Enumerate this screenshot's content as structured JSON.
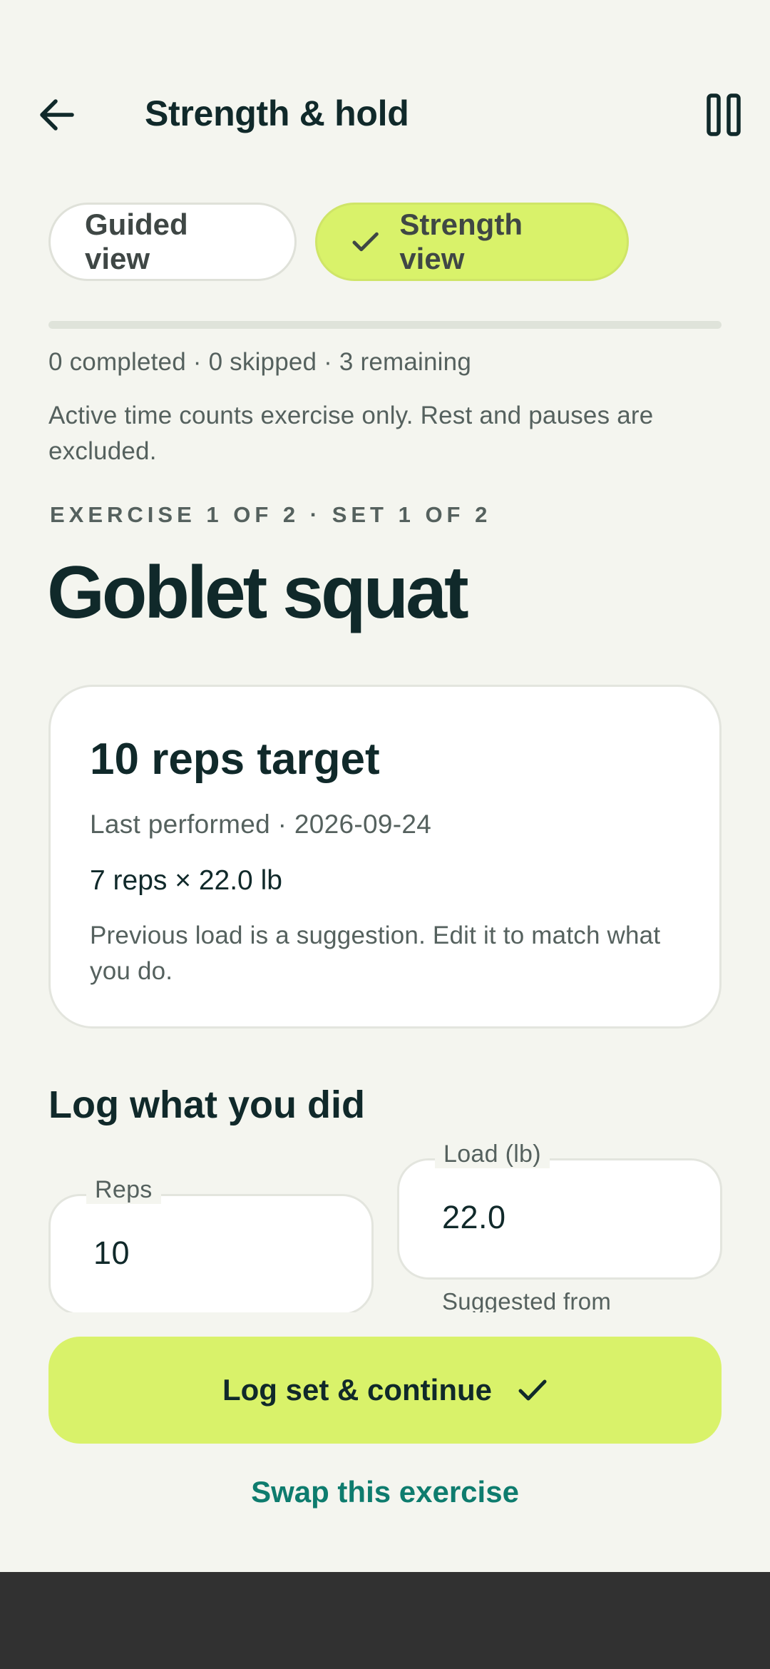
{
  "header": {
    "title": "Strength & hold",
    "back_icon": "arrow-left-icon",
    "pause_icon": "pause-icon"
  },
  "view_toggle": {
    "options": [
      {
        "label": "Guided view",
        "selected": false
      },
      {
        "label": "Strength view",
        "selected": true,
        "icon": "check-icon"
      }
    ]
  },
  "progress": {
    "fraction": 0,
    "stats": "0 completed · 0 skipped · 3 remaining",
    "note": "Active time counts exercise only. Rest and pauses are excluded."
  },
  "exercise": {
    "eyebrow": "EXERCISE 1 OF 2 · SET 1 OF 2",
    "name": "Goblet squat"
  },
  "target_card": {
    "title": "10 reps target",
    "last_performed": "Last performed · 2026-09-24",
    "last_result": "7 reps × 22.0 lb",
    "hint": "Previous load is a suggestion. Edit it to match what you do."
  },
  "log": {
    "heading": "Log what you did",
    "reps": {
      "label": "Reps",
      "value": "10"
    },
    "load": {
      "label": "Load (lb)",
      "value": "22.0",
      "helper": "Suggested from"
    }
  },
  "actions": {
    "primary_label": "Log set & continue",
    "primary_icon": "check-icon",
    "swap_label": "Swap this exercise"
  },
  "colors": {
    "background": "#f4f5ef",
    "accent_lime": "#d9f26a",
    "teal_link": "#0e7c6e",
    "ink": "#10292a",
    "muted": "#55615e"
  }
}
